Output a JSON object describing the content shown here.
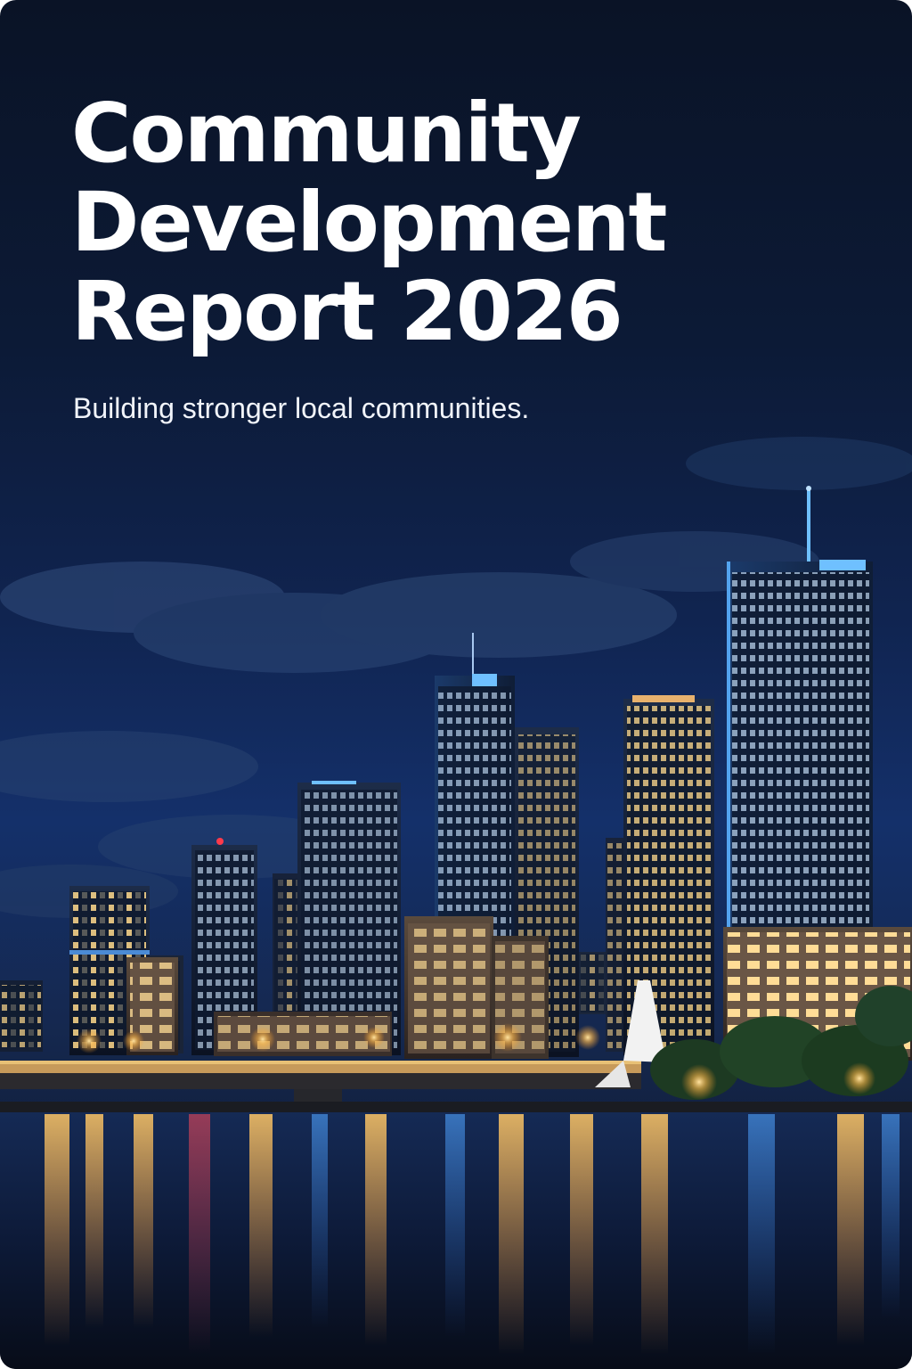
{
  "cover": {
    "title_lines": [
      "Community",
      "Development",
      "Report 2026"
    ],
    "subtitle": "Building stronger local communities."
  },
  "colors": {
    "sky_top": "#0a1326",
    "sky_mid": "#14306a",
    "text": "#ffffff",
    "window_light": "#ffd98a",
    "building_glow": "#4fa3ff",
    "water": "#0d1830"
  },
  "image": {
    "subject": "night-city-skyline-over-river-icon"
  }
}
